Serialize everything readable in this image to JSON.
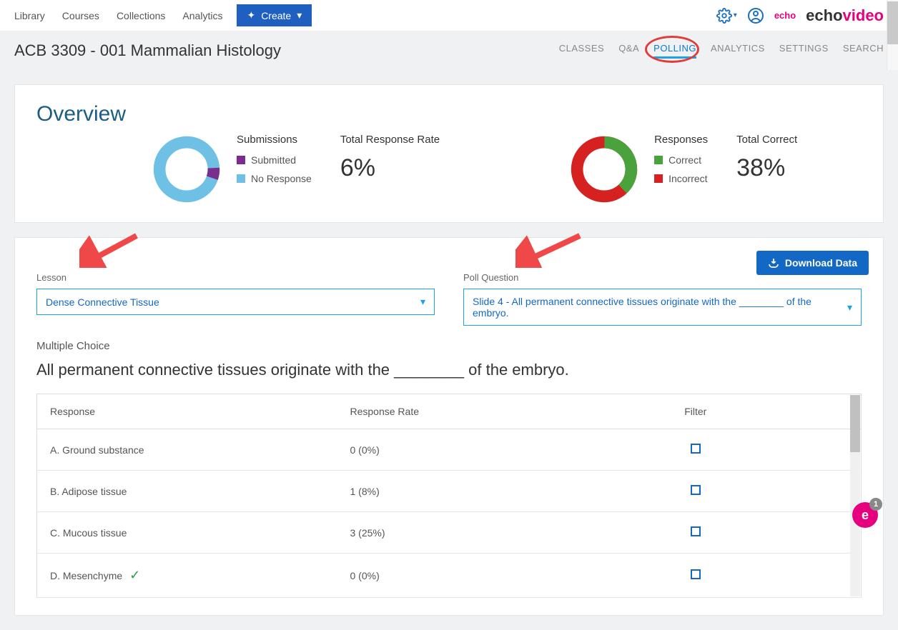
{
  "topnav": {
    "links": [
      "Library",
      "Courses",
      "Collections",
      "Analytics"
    ],
    "create_label": "Create",
    "brand_small": "echo",
    "brand_large_dark": "echo",
    "brand_large_pink": "video"
  },
  "subheader": {
    "course_title": "ACB 3309 - 001 Mammalian Histology",
    "tabs": [
      "CLASSES",
      "Q&A",
      "POLLING",
      "ANALYTICS",
      "SETTINGS",
      "SEARCH"
    ],
    "active_tab": "POLLING"
  },
  "overview": {
    "title": "Overview",
    "submissions": {
      "label": "Submissions",
      "legend": [
        {
          "color": "#7b2d8e",
          "label": "Submitted"
        },
        {
          "color": "#6ec1e4",
          "label": "No Response"
        }
      ]
    },
    "response_rate": {
      "label": "Total Response Rate",
      "value": "6%"
    },
    "responses": {
      "label": "Responses",
      "legend": [
        {
          "color": "#4aa23c",
          "label": "Correct"
        },
        {
          "color": "#d62121",
          "label": "Incorrect"
        }
      ]
    },
    "total_correct": {
      "label": "Total Correct",
      "value": "38%"
    }
  },
  "filters": {
    "download_label": "Download Data",
    "lesson_label": "Lesson",
    "lesson_value": "Dense Connective Tissue",
    "question_label": "Poll Question",
    "question_value": "Slide 4 - All permanent connective tissues originate with the ________ of the embryo."
  },
  "question": {
    "type": "Multiple Choice",
    "text": "All permanent connective tissues originate with the ________ of the embryo."
  },
  "table": {
    "headers": {
      "response": "Response",
      "rate": "Response Rate",
      "filter": "Filter"
    },
    "rows": [
      {
        "label": "A.  Ground substance",
        "rate": "0 (0%)",
        "correct": false
      },
      {
        "label": "B.  Adipose tissue",
        "rate": "1 (8%)",
        "correct": false
      },
      {
        "label": "C.  Mucous tissue",
        "rate": "3 (25%)",
        "correct": false
      },
      {
        "label": "D.  Mesenchyme",
        "rate": "0 (0%)",
        "correct": true
      }
    ]
  },
  "floating": {
    "letter": "e",
    "count": "1"
  },
  "chart_data": [
    {
      "type": "pie",
      "title": "Submissions",
      "series": [
        {
          "name": "Submitted",
          "value": 6
        },
        {
          "name": "No Response",
          "value": 94
        }
      ]
    },
    {
      "type": "pie",
      "title": "Responses",
      "series": [
        {
          "name": "Correct",
          "value": 38
        },
        {
          "name": "Incorrect",
          "value": 62
        }
      ]
    }
  ]
}
